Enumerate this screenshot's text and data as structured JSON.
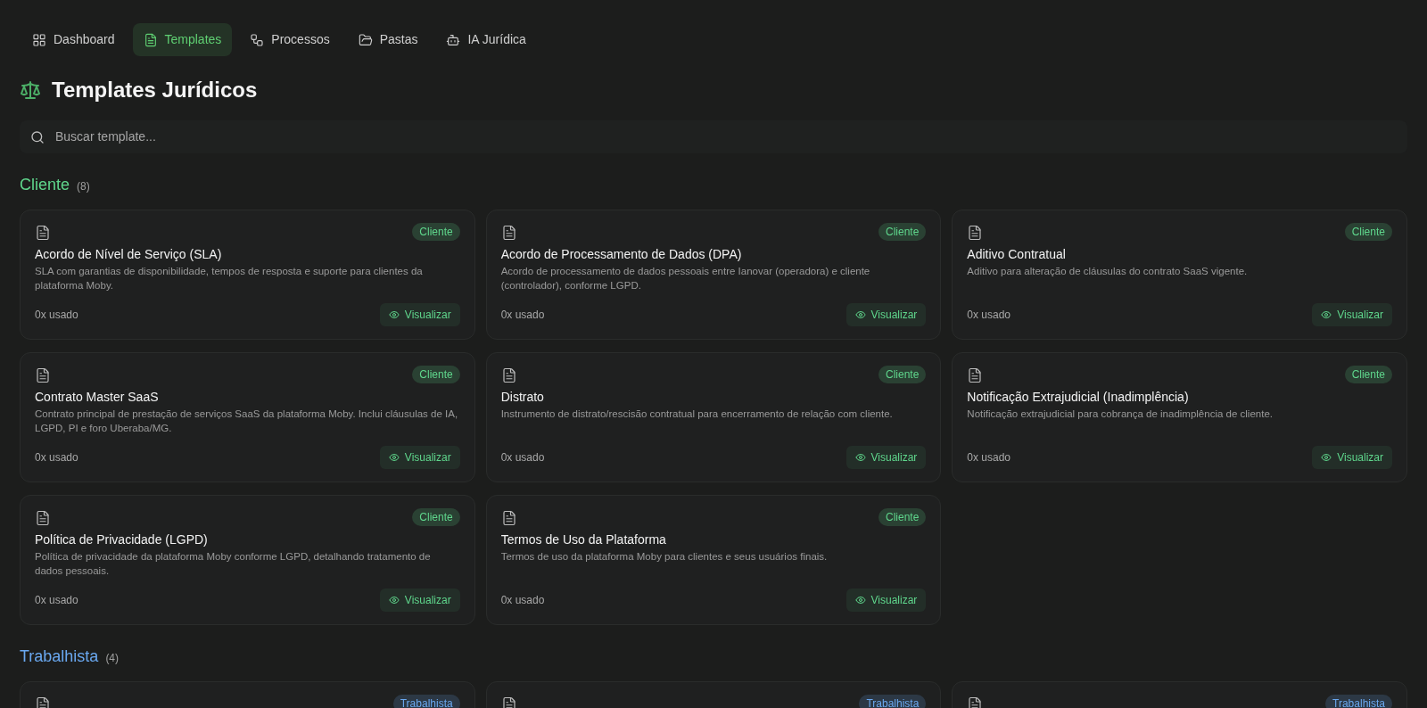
{
  "nav": [
    {
      "label": "Dashboard",
      "selected": false
    },
    {
      "label": "Templates",
      "selected": true
    },
    {
      "label": "Processos",
      "selected": false
    },
    {
      "label": "Pastas",
      "selected": false
    },
    {
      "label": "IA Jurídica",
      "selected": false
    }
  ],
  "page_title": "Templates Jurídicos",
  "search": {
    "placeholder": "Buscar template..."
  },
  "sections": [
    {
      "name": "Cliente",
      "count": "(8)",
      "color": "#5fd68c",
      "templates": [
        {
          "title": "Acordo de Nível de Serviço (SLA)",
          "badge": "Cliente",
          "description": "SLA com garantias de disponibilidade, tempos de resposta e suporte para clientes da plataforma Moby.",
          "usage": "0x usado",
          "action": "Visualizar"
        },
        {
          "title": "Acordo de Processamento de Dados (DPA)",
          "badge": "Cliente",
          "description": "Acordo de processamento de dados pessoais entre Ianovar (operadora) e cliente (controlador), conforme LGPD.",
          "usage": "0x usado",
          "action": "Visualizar"
        },
        {
          "title": "Aditivo Contratual",
          "badge": "Cliente",
          "description": "Aditivo para alteração de cláusulas do contrato SaaS vigente.",
          "usage": "0x usado",
          "action": "Visualizar"
        },
        {
          "title": "Contrato Master SaaS",
          "badge": "Cliente",
          "description": "Contrato principal de prestação de serviços SaaS da plataforma Moby. Inclui cláusulas de IA, LGPD, PI e foro Uberaba/MG.",
          "usage": "0x usado",
          "action": "Visualizar"
        },
        {
          "title": "Distrato",
          "badge": "Cliente",
          "description": "Instrumento de distrato/rescisão contratual para encerramento de relação com cliente.",
          "usage": "0x usado",
          "action": "Visualizar"
        },
        {
          "title": "Notificação Extrajudicial (Inadimplência)",
          "badge": "Cliente",
          "description": "Notificação extrajudicial para cobrança de inadimplência de cliente.",
          "usage": "0x usado",
          "action": "Visualizar"
        },
        {
          "title": "Política de Privacidade (LGPD)",
          "badge": "Cliente",
          "description": "Política de privacidade da plataforma Moby conforme LGPD, detalhando tratamento de dados pessoais.",
          "usage": "0x usado",
          "action": "Visualizar"
        },
        {
          "title": "Termos de Uso da Plataforma",
          "badge": "Cliente",
          "description": "Termos de uso da plataforma Moby para clientes e seus usuários finais.",
          "usage": "0x usado",
          "action": "Visualizar"
        }
      ]
    },
    {
      "name": "Trabalhista",
      "count": "(4)",
      "color": "#6aa8f0",
      "templates": [
        {
          "badge": "Trabalhista"
        },
        {
          "badge": "Trabalhista"
        },
        {
          "badge": "Trabalhista"
        }
      ]
    }
  ]
}
